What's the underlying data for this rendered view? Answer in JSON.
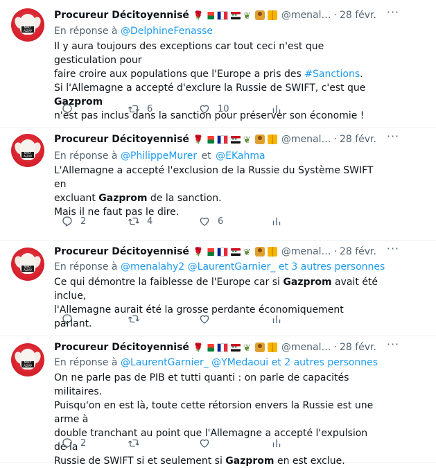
{
  "tweets": [
    {
      "author": "Procureur Décitoyennisé",
      "handle": "@menal…",
      "time": "28 févr.",
      "reply_prefix": "En réponse à",
      "reply_to": [
        "@DelphineFenasse"
      ],
      "reply_extra": "",
      "lines": [
        [
          {
            "t": "Il y aura toujours des exceptions car tout ceci n'est que gesticulation pour"
          }
        ],
        [
          {
            "t": "faire croire aux populations que l'Europe a pris des "
          },
          {
            "t": "#Sanctions",
            "s": "hl"
          },
          {
            "t": "."
          }
        ],
        [
          {
            "t": "Si l'Allemagne a accepté d'exclure la Russie de SWIFT, c'est que "
          },
          {
            "t": "Gazprom",
            "s": "b"
          }
        ],
        [
          {
            "t": "n'est pas inclus dans la sanction pour préserver son économie !"
          }
        ]
      ],
      "reply_count": "",
      "retweet_count": "6",
      "like_count": "10"
    },
    {
      "author": "Procureur Décitoyennisé",
      "handle": "@menal…",
      "time": "28 févr.",
      "reply_prefix": "En réponse à",
      "reply_to": [
        "@PhilippeMurer",
        "et",
        "@EKahma"
      ],
      "reply_extra": "",
      "lines": [
        [
          {
            "t": "L'Allemagne a accepté l'exclusion de la Russie du Système SWIFT en"
          }
        ],
        [
          {
            "t": "excluant "
          },
          {
            "t": "Gazprom",
            "s": "b"
          },
          {
            "t": " de la sanction."
          }
        ],
        [
          {
            "t": "Mais il ne faut pas le dire."
          }
        ]
      ],
      "reply_count": "2",
      "retweet_count": "4",
      "like_count": "6"
    },
    {
      "author": "Procureur Décitoyennisé",
      "handle": "@menal…",
      "time": "28 févr.",
      "reply_prefix": "En réponse à",
      "reply_to": [
        "@menalahy2",
        "@LaurentGarnier_",
        "et 3 autres personnes"
      ],
      "reply_extra": "",
      "lines": [
        [
          {
            "t": "Ce qui démontre la faiblesse de l'Europe car si "
          },
          {
            "t": "Gazprom",
            "s": "b"
          },
          {
            "t": " avait été inclue,"
          }
        ],
        [
          {
            "t": "l'Allemagne aurait été la grosse perdante économiquement parlant."
          }
        ]
      ],
      "reply_count": "",
      "retweet_count": "",
      "like_count": ""
    },
    {
      "author": "Procureur Décitoyennisé",
      "handle": "@menal…",
      "time": "28 févr.",
      "reply_prefix": "En réponse à",
      "reply_to": [
        "@LaurentGarnier_",
        "@YMedaoui",
        "et 2 autres personnes"
      ],
      "reply_extra": "",
      "lines": [
        [
          {
            "t": "On ne parle pas de PIB et tutti quanti : on parle de capacités militaires."
          }
        ],
        [
          {
            "t": "Puisqu'on en est là, toute cette rétorsion envers la Russie est une arme à"
          }
        ],
        [
          {
            "t": "double tranchant au point que l'Allemagne a accepté l'expulsion de la"
          }
        ],
        [
          {
            "t": "Russie de SWIFT si et seulement si "
          },
          {
            "t": "Gazprom",
            "s": "b"
          },
          {
            "t": " en est exclue."
          }
        ]
      ],
      "reply_count": "2",
      "retweet_count": "",
      "like_count": ""
    }
  ],
  "avatar_sign": "NAKY AIZAP",
  "icons": {
    "reply": "reply-icon",
    "retweet": "retweet-icon",
    "like": "like-icon",
    "analytics": "analytics-icon",
    "more": "more-icon"
  },
  "colors": {
    "link": "#1d9bf0",
    "muted": "#536471",
    "text": "#0f1419",
    "avatar_bg": "#d8232e"
  }
}
